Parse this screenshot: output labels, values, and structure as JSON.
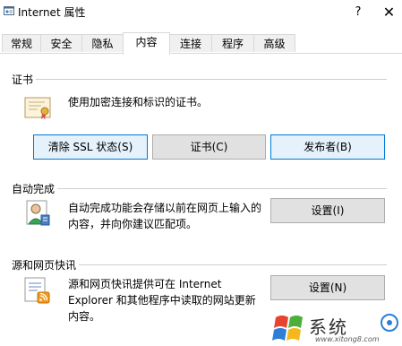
{
  "window": {
    "title": "Internet 属性",
    "help_glyph": "?",
    "close_glyph": "✕"
  },
  "tabs": [
    "常规",
    "安全",
    "隐私",
    "内容",
    "连接",
    "程序",
    "高级"
  ],
  "sections": {
    "certificates": {
      "heading": "证书",
      "description": "使用加密连接和标识的证书。",
      "buttons": [
        "清除 SSL 状态(S)",
        "证书(C)",
        "发布者(B)"
      ]
    },
    "autocomplete": {
      "heading": "自动完成",
      "description_lines": [
        "自动完成功能会存储以前在网页上输入的",
        "内容，并向你建议匹配项。"
      ],
      "button": "设置(I)"
    },
    "feeds": {
      "heading": "源和网页快讯",
      "description_lines": [
        "源和网页快讯提供可在 Internet",
        "Explorer 和其他程序中读取的网站更新",
        "内容。"
      ],
      "button": "设置(N)"
    }
  },
  "watermark": {
    "text": "系统",
    "url": "www.xitong8.com"
  }
}
